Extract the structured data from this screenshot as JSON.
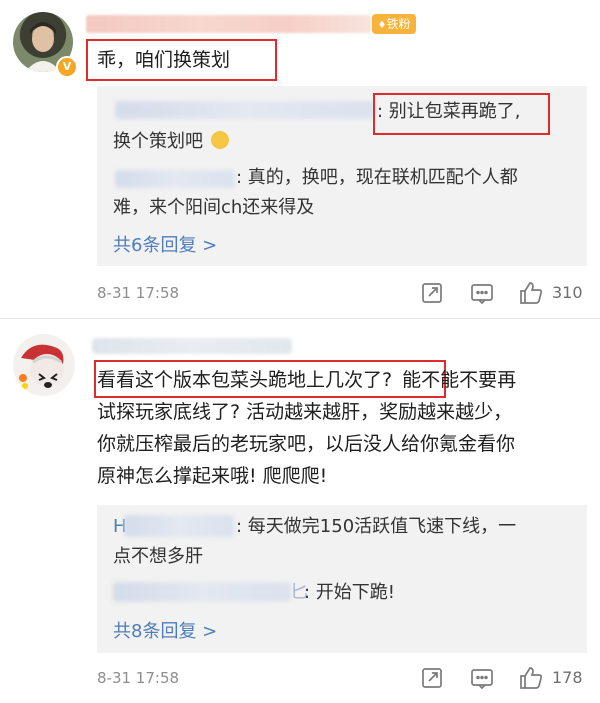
{
  "comments": [
    {
      "badge": "铁粉",
      "text": "乖，咱们换策划",
      "replies": [
        {
          "text_1": ": 别让包菜再跪了,",
          "text_2": "换个策划吧"
        },
        {
          "text_1": ": 真的，换吧，现在联机匹配个人都",
          "text_2": "难，来个阳间ch还来得及"
        }
      ],
      "more_replies": "共6条回复 >",
      "time": "8-31 17:58",
      "likes": "310"
    },
    {
      "text_highlight": "看看这个版本包菜头跪地上几次了?",
      "text_rest_1": "能不能不要再",
      "text_lines": [
        "试探玩家底线了? 活动越来越肝，奖励越来越少，",
        "你就压榨最后的老玩家吧，以后没人给你氪金看你",
        "原神怎么撑起来哦! 爬爬爬!"
      ],
      "replies": [
        {
          "prefix": "H",
          "text_1": ": 每天做完150活跃值飞速下线，一",
          "text_2": "点不想多肝"
        },
        {
          "prefix": "匕",
          "text_1": ": 开始下跪!"
        }
      ],
      "more_replies": "共8条回复 >",
      "time": "8-31 17:58",
      "likes": "178"
    }
  ],
  "colors": {
    "highlight": "#e02b2b",
    "link": "#4f7db9",
    "reply_bg": "#f2f2f2"
  },
  "icons": [
    "share-icon",
    "comment-icon",
    "like-icon",
    "verified-badge-icon",
    "fan-badge-icon"
  ]
}
